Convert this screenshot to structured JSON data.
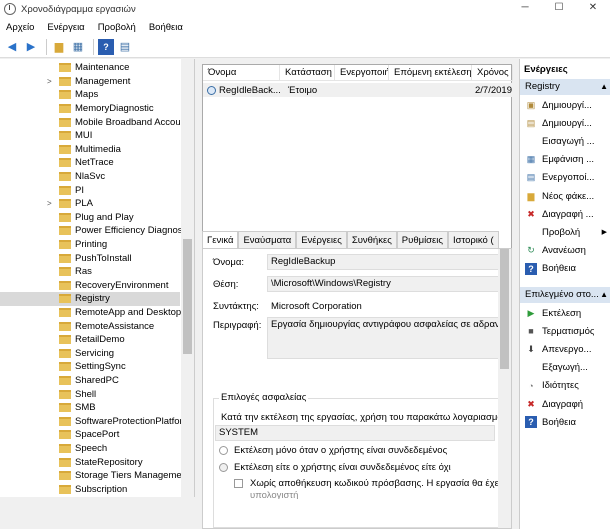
{
  "window": {
    "title": "Χρονοδιάγραμμα εργασιών",
    "minimize": "─",
    "maximize": "☐",
    "close": "✕"
  },
  "menu": [
    "Αρχείο",
    "Ενέργεια",
    "Προβολή",
    "Βοήθεια"
  ],
  "tree": [
    {
      "label": "Maintenance",
      "exp": ""
    },
    {
      "label": "Management",
      "exp": ">"
    },
    {
      "label": "Maps",
      "exp": ""
    },
    {
      "label": "MemoryDiagnostic",
      "exp": ""
    },
    {
      "label": "Mobile Broadband Accour",
      "exp": ""
    },
    {
      "label": "MUI",
      "exp": ""
    },
    {
      "label": "Multimedia",
      "exp": ""
    },
    {
      "label": "NetTrace",
      "exp": ""
    },
    {
      "label": "NlaSvc",
      "exp": ""
    },
    {
      "label": "PI",
      "exp": ""
    },
    {
      "label": "PLA",
      "exp": ">"
    },
    {
      "label": "Plug and Play",
      "exp": ""
    },
    {
      "label": "Power Efficiency Diagnosti",
      "exp": ""
    },
    {
      "label": "Printing",
      "exp": ""
    },
    {
      "label": "PushToInstall",
      "exp": ""
    },
    {
      "label": "Ras",
      "exp": ""
    },
    {
      "label": "RecoveryEnvironment",
      "exp": ""
    },
    {
      "label": "Registry",
      "exp": "",
      "selected": true
    },
    {
      "label": "RemoteApp and Desktop C",
      "exp": ""
    },
    {
      "label": "RemoteAssistance",
      "exp": ""
    },
    {
      "label": "RetailDemo",
      "exp": ""
    },
    {
      "label": "Servicing",
      "exp": ""
    },
    {
      "label": "SettingSync",
      "exp": ""
    },
    {
      "label": "SharedPC",
      "exp": ""
    },
    {
      "label": "Shell",
      "exp": ""
    },
    {
      "label": "SMB",
      "exp": ""
    },
    {
      "label": "SoftwareProtectionPlatforn",
      "exp": ""
    },
    {
      "label": "SpacePort",
      "exp": ""
    },
    {
      "label": "Speech",
      "exp": ""
    },
    {
      "label": "StateRepository",
      "exp": ""
    },
    {
      "label": "Storage Tiers Management",
      "exp": ""
    },
    {
      "label": "Subscription",
      "exp": ""
    }
  ],
  "task_columns": [
    "Όνομα",
    "Κατάσταση",
    "Ενεργοποιήσεις",
    "Επόμενη εκτέλεση",
    "Χρόνος"
  ],
  "task_row": {
    "name": "RegIdleBack...",
    "status": "Έτοιμο",
    "next_run": "2/7/2019"
  },
  "tabs": [
    "Γενικά",
    "Εναύσματα",
    "Ενέργειες",
    "Συνθήκες",
    "Ρυθμίσεις",
    "Ιστορικό ("
  ],
  "general": {
    "name_label": "Όνομα:",
    "name_value": "RegIdleBackup",
    "location_label": "Θέση:",
    "location_value": "\\Microsoft\\Windows\\Registry",
    "author_label": "Συντάκτης:",
    "author_value": "Microsoft Corporation",
    "desc_label": "Περιγραφή:",
    "desc_value": "Εργασία δημιουργίας αντιγράφου ασφαλείας σε αδρανή",
    "security_legend": "Επιλογές ασφαλείας",
    "run_account_text": "Κατά την εκτέλεση της εργασίας, χρήση του παρακάτω λογαριασμο",
    "account": "SYSTEM",
    "radio1": "Εκτέλεση μόνο όταν ο χρήστης είναι συνδεδεμένος",
    "radio2": "Εκτέλεση είτε ο χρήστης είναι συνδεδεμένος είτε όχι",
    "checkbox": "Χωρίς αποθήκευση κωδικού πρόσβασης.  Η εργασία θα έχει",
    "checkbox_cont": "υπολογιστή"
  },
  "actions": {
    "title": "Ενέργειες",
    "section1": "Registry",
    "items1": [
      {
        "icon": "create-task-icon",
        "label": "Δημιουργί..."
      },
      {
        "icon": "create-basic-task-icon",
        "label": "Δημιουργί..."
      },
      {
        "icon": "import-icon",
        "label": "Εισαγωγή ..."
      },
      {
        "icon": "display-icon",
        "label": "Εμφάνιση ..."
      },
      {
        "icon": "enable-icon",
        "label": "Ενεργοποί..."
      },
      {
        "icon": "new-folder-icon",
        "label": "Νέος φάκε..."
      },
      {
        "icon": "delete-icon",
        "label": "Διαγραφή ..."
      },
      {
        "icon": "view-icon",
        "label": "Προβολή"
      },
      {
        "icon": "refresh-icon",
        "label": "Ανανέωση"
      },
      {
        "icon": "help-icon",
        "label": "Βοήθεια"
      }
    ],
    "section2": "Επιλεγμένο στο...",
    "items2": [
      {
        "icon": "run-icon",
        "label": "Εκτέλεση"
      },
      {
        "icon": "end-icon",
        "label": "Τερματισμός"
      },
      {
        "icon": "disable-icon",
        "label": "Απενεργο..."
      },
      {
        "icon": "export-icon",
        "label": "Εξαγωγή..."
      },
      {
        "icon": "properties-icon",
        "label": "Ιδιότητες"
      },
      {
        "icon": "delete-icon",
        "label": "Διαγραφή"
      },
      {
        "icon": "help-icon",
        "label": "Βοήθεια"
      }
    ]
  }
}
